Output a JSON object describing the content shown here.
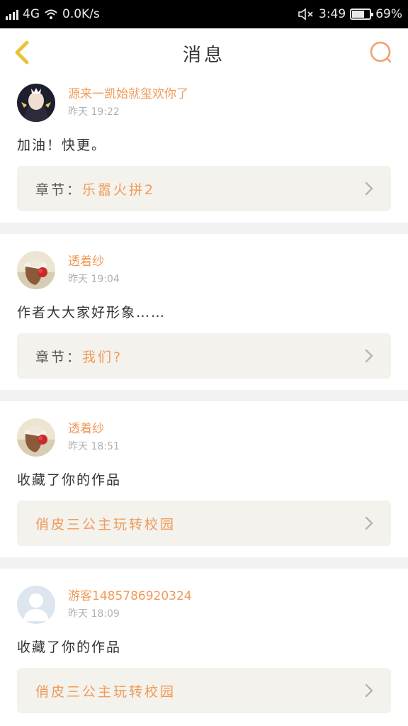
{
  "status_bar": {
    "network": "4G",
    "speed": "0.0K/s",
    "time": "3:49",
    "battery_text": "69%",
    "battery_level": 0.69
  },
  "nav": {
    "title": "消息"
  },
  "messages": [
    {
      "username": "源来一凯始就玺欢你了",
      "time": "昨天 19:22",
      "text": "加油！快更。",
      "chapter_prefix": "章节：",
      "chapter_name": "乐嚣火拼2"
    },
    {
      "username": "透着纱",
      "time": "昨天 19:04",
      "text": "作者大大家好形象……",
      "chapter_prefix": "章节：",
      "chapter_name": "我们?"
    },
    {
      "username": "透着纱",
      "time": "昨天 18:51",
      "text": "收藏了你的作品",
      "chapter_prefix": "",
      "chapter_name": "俏皮三公主玩转校园"
    },
    {
      "username": "游客1485786920324",
      "time": "昨天 18:09",
      "text": "收藏了你的作品",
      "chapter_prefix": "",
      "chapter_name": "俏皮三公主玩转校园"
    }
  ],
  "colors": {
    "accent": "#f09a5a",
    "back_icon": "#e8c23a",
    "search_icon": "#f0a070",
    "card_bg": "#f3f2ec"
  }
}
